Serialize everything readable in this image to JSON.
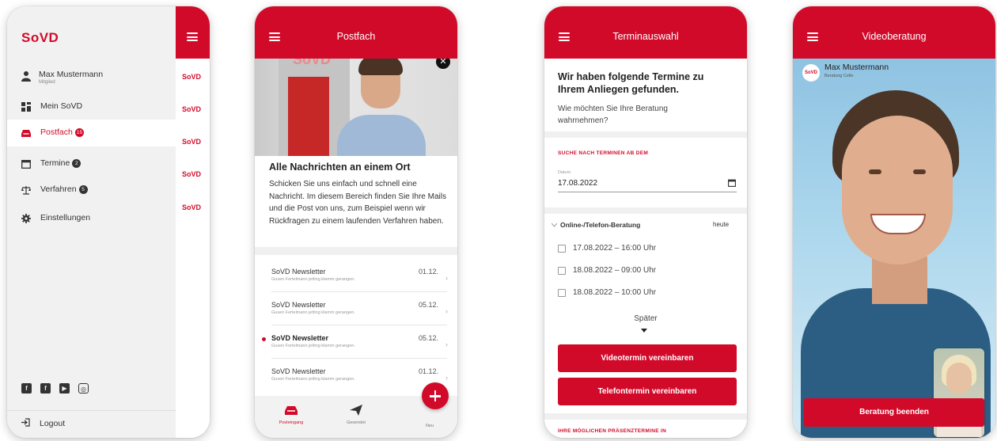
{
  "menu_screen": {
    "brand": "SoVD",
    "user_name": "Max Mustermann",
    "user_role": "Mitglied",
    "nav": [
      {
        "label": "Mein SoVD",
        "badge": ""
      },
      {
        "label": "Postfach",
        "badge": "15"
      },
      {
        "label": "Termine",
        "badge": "2"
      },
      {
        "label": "Verfahren",
        "badge": "5"
      },
      {
        "label": "Einstellungen",
        "badge": ""
      }
    ],
    "social": [
      "f",
      "f",
      "▶",
      "◎"
    ],
    "logout": "Logout",
    "behind_logo": "SoVD"
  },
  "postfach_screen": {
    "title": "Postfach",
    "hero_sign": "SoVD",
    "close_glyph": "✕",
    "card_title": "Alle Nachrichten an einem Ort",
    "card_text": "Schicken Sie uns einfach und schnell eine Nachricht. Im diesem Bereich finden Sie Ihre Mails und die Post von uns, zum Beispiel wenn wir Rückfragen zu einem laufenden Verfahren haben.",
    "messages": [
      {
        "title": "SoVD Newsletter",
        "sub": "Gusen Fertelmann jetting klamm gerangen.",
        "date": "01.12."
      },
      {
        "title": "SoVD Newsletter",
        "sub": "Gusen Fertelmann jetting klamm gerangen.",
        "date": "05.12."
      },
      {
        "title": "SoVD Newsletter",
        "sub": "Gusen Fertelmann jetting klamm gerangen.",
        "date": "05.12."
      },
      {
        "title": "SoVD Newsletter",
        "sub": "Gusen Fertelmann jetting klamm gerangen.",
        "date": "01.12."
      }
    ],
    "chevron": "›",
    "tabs": {
      "inbox": "Posteingang",
      "sent": "Gesendet",
      "new": "Neu"
    }
  },
  "termin_screen": {
    "title": "Terminauswahl",
    "headline": "Wir haben folgende Termine zu Ihrem Anliegen gefunden.",
    "question": "Wie möchten Sie Ihre Beratung wahrnehmen?",
    "search_head": "SUCHE NACH TERMINEN AB DEM",
    "date_label": "Datum",
    "date_value": "17.08.2022",
    "accordion_title": "Online-/Telefon-Beratung",
    "today_link": "heute",
    "slots": [
      "17.08.2022 – 16:00 Uhr",
      "18.08.2022 – 09:00 Uhr",
      "18.08.2022 – 10:00 Uhr"
    ],
    "later": "Später",
    "video_button": "Videotermin vereinbaren",
    "phone_button": "Telefontermin vereinbaren",
    "presence_head": "IHRE MÖGLICHEN PRÄSENZTERMINE IN"
  },
  "video_screen": {
    "title": "Videoberatung",
    "caller_logo": "SoVD",
    "caller_name": "Max Mustermann",
    "caller_sub": "Beratung Celle",
    "end_button": "Beratung beenden"
  },
  "colors": {
    "brand_red": "#d20a2a"
  }
}
